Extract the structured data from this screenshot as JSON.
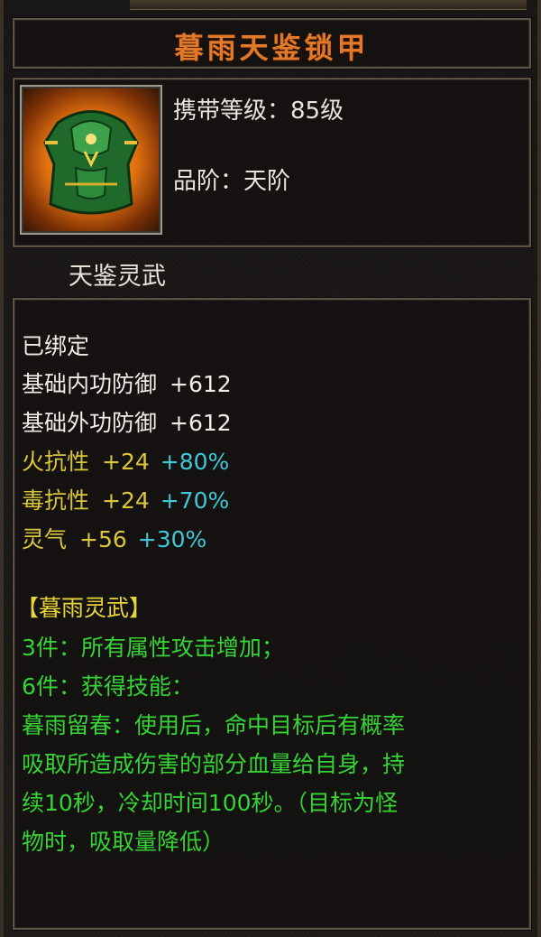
{
  "item": {
    "name": "暮雨天鉴锁甲",
    "icon": "armor-icon",
    "required_level": "携带等级：85级",
    "grade": "品阶：天阶"
  },
  "set_name": "天鉴灵武",
  "stats": {
    "bound": "已绑定",
    "base_inner_def": {
      "label": "基础内功防御",
      "value": "+612"
    },
    "base_outer_def": {
      "label": "基础外功防御",
      "value": "+612"
    },
    "fire_res": {
      "label": "火抗性",
      "value": "+24",
      "bonus": "+80%"
    },
    "poison_res": {
      "label": "毒抗性",
      "value": "+24",
      "bonus": "+70%"
    },
    "spirit": {
      "label": "灵气",
      "value": "+56",
      "bonus": "+30%"
    }
  },
  "set_bonus": {
    "title": "【暮雨灵武】",
    "bonus3": "3件：所有属性攻击增加；",
    "bonus6": "6件：获得技能：",
    "desc_lines": [
      "暮雨留春：使用后，命中目标后有概率",
      "吸取所造成伤害的部分血量给自身，持",
      "续10秒，冷却时间100秒。（目标为怪",
      "物时，吸取量降低）"
    ]
  },
  "colors": {
    "title": "#e07a2a",
    "white": "#f0ede6",
    "yellow": "#d9c63a",
    "cyan": "#40c8d8",
    "green": "#35d335"
  }
}
